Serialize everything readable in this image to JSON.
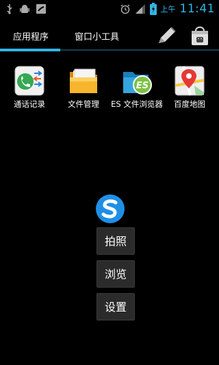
{
  "status_bar": {
    "left_icons": [
      "usb-icon",
      "android-debug-icon",
      "missed-call-icon"
    ],
    "right_icons": [
      "alarm-icon",
      "signal-icon",
      "battery-charging-icon"
    ],
    "ampm": "上午",
    "time": "11:41"
  },
  "tabs": {
    "apps": "应用程序",
    "widgets": "窗口小工具"
  },
  "actions": {
    "edit_icon": "pencil-icon",
    "market_icon": "market-bag-icon"
  },
  "apps": [
    {
      "label": "通话记录",
      "icon": "call-log-icon"
    },
    {
      "label": "文件管理",
      "icon": "folder-icon"
    },
    {
      "label": "ES 文件浏览器",
      "icon": "es-file-explorer-icon"
    },
    {
      "label": "百度地图",
      "icon": "baidu-map-icon"
    }
  ],
  "widget": {
    "logo_icon": "s-logo-icon",
    "buttons": {
      "photo": "拍照",
      "browse": "浏览",
      "settings": "设置"
    }
  },
  "colors": {
    "accent": "#33b5e5",
    "background": "#000000",
    "button_bg": "#2b2b2b"
  }
}
